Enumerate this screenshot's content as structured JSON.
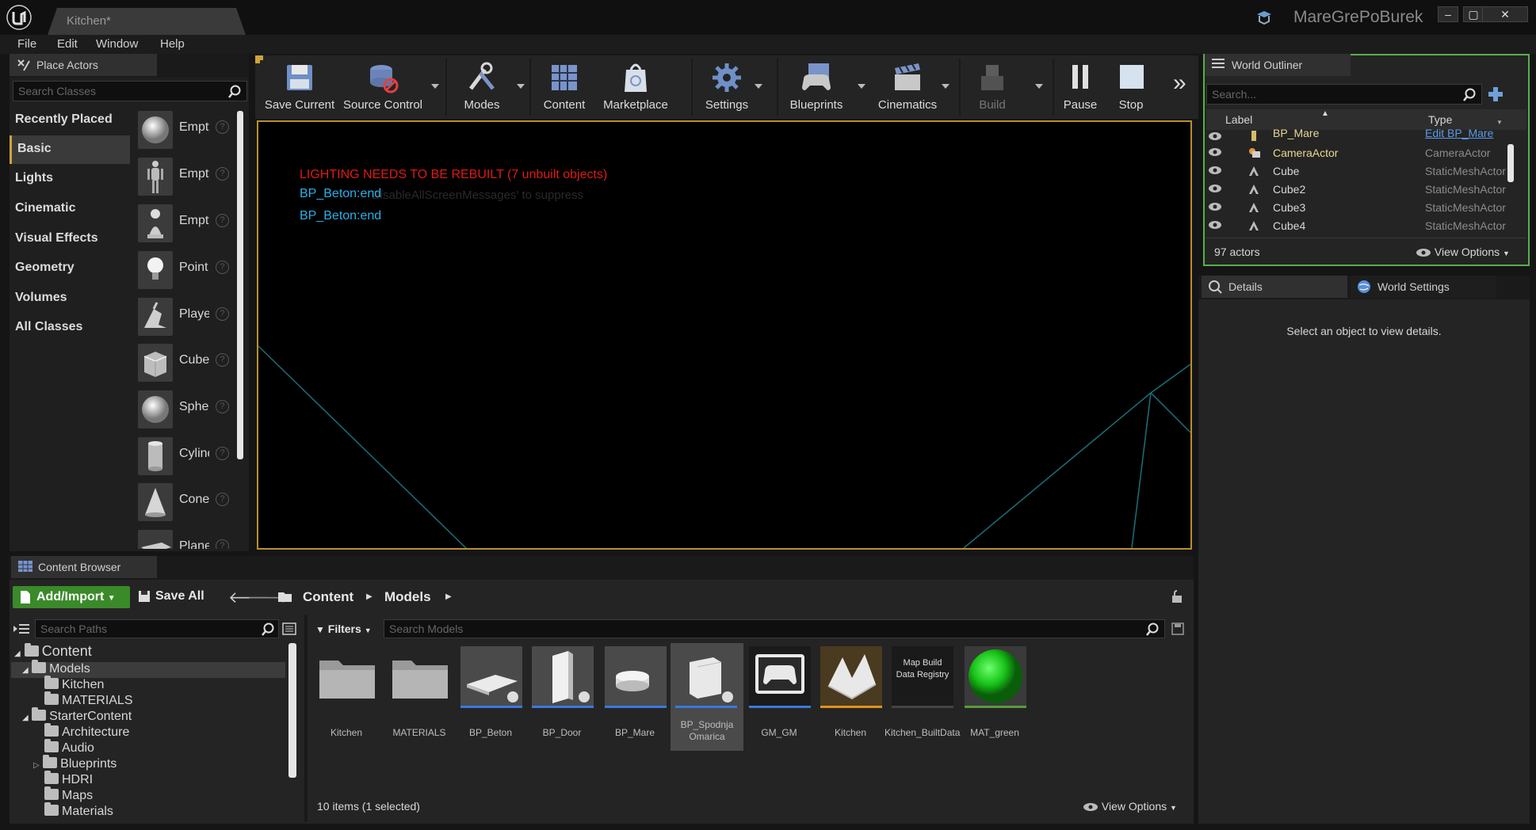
{
  "app": {
    "document_tab": "Kitchen*",
    "project_name": "MareGrePoBurek",
    "window_buttons": [
      "–",
      "▢",
      "✕"
    ]
  },
  "menu": [
    "File",
    "Edit",
    "Window",
    "Help"
  ],
  "place_actors": {
    "tab_label": "Place Actors",
    "search_placeholder": "Search Classes",
    "categories": [
      "Recently Placed",
      "Basic",
      "Lights",
      "Cinematic",
      "Visual Effects",
      "Geometry",
      "Volumes",
      "All Classes"
    ],
    "selected_category": "Basic",
    "actors": [
      "Empty Actor",
      "Empty Character",
      "Empty Pawn",
      "Point Light",
      "Player Start",
      "Cube",
      "Sphere",
      "Cylinder",
      "Cone",
      "Plane"
    ]
  },
  "toolbar": {
    "buttons": [
      "Save Current",
      "Source Control",
      "Modes",
      "Content",
      "Marketplace",
      "Settings",
      "Blueprints",
      "Cinematics",
      "Build",
      "Pause",
      "Stop"
    ],
    "overflow": "»"
  },
  "viewport": {
    "warning": "LIGHTING NEEDS TO BE REBUILT (7 unbuilt objects)",
    "messages": [
      "BP_Beton:end",
      "BP_Beton:end"
    ],
    "faded_hint": "'DisableAllScreenMessages' to suppress"
  },
  "outliner": {
    "tab_label": "World Outliner",
    "search_placeholder": "Search...",
    "columns": [
      "Label",
      "Type"
    ],
    "rows": [
      {
        "label": "BP_Mare",
        "type": "Edit BP_Mare",
        "icon": "blueprint-icon"
      },
      {
        "label": "CameraActor",
        "type": "CameraActor",
        "icon": "camera-icon"
      },
      {
        "label": "Cube",
        "type": "StaticMeshActor",
        "icon": "static-mesh-icon"
      },
      {
        "label": "Cube2",
        "type": "StaticMeshActor",
        "icon": "static-mesh-icon"
      },
      {
        "label": "Cube3",
        "type": "StaticMeshActor",
        "icon": "static-mesh-icon"
      },
      {
        "label": "Cube4",
        "type": "StaticMeshActor",
        "icon": "static-mesh-icon"
      }
    ],
    "actor_count": "97 actors",
    "view_options": "View Options"
  },
  "details": {
    "tabs": [
      "Details",
      "World Settings"
    ],
    "empty_message": "Select an object to view details."
  },
  "content_browser": {
    "tab_label": "Content Browser",
    "add_import": "Add/Import",
    "save_all": "Save All",
    "breadcrumb": [
      "Content",
      "Models"
    ],
    "paths_search_placeholder": "Search Paths",
    "filters_label": "Filters",
    "models_search_placeholder": "Search Models",
    "tree": [
      {
        "label": "Content",
        "level": 0
      },
      {
        "label": "Models",
        "level": 1
      },
      {
        "label": "Kitchen",
        "level": 2
      },
      {
        "label": "MATERIALS",
        "level": 2
      },
      {
        "label": "StarterContent",
        "level": 1
      },
      {
        "label": "Architecture",
        "level": 2
      },
      {
        "label": "Audio",
        "level": 2
      },
      {
        "label": "Blueprints",
        "level": 2
      },
      {
        "label": "HDRI",
        "level": 2
      },
      {
        "label": "Maps",
        "level": 2
      },
      {
        "label": "Materials",
        "level": 2
      }
    ],
    "assets": [
      {
        "name": "Kitchen",
        "kind": "folder"
      },
      {
        "name": "MATERIALS",
        "kind": "folder"
      },
      {
        "name": "BP_Beton",
        "kind": "blueprint"
      },
      {
        "name": "BP_Door",
        "kind": "blueprint"
      },
      {
        "name": "BP_Mare",
        "kind": "blueprint"
      },
      {
        "name": "BP_Spodnja Omarica",
        "kind": "blueprint"
      },
      {
        "name": "GM_GM",
        "kind": "gamemode"
      },
      {
        "name": "Kitchen",
        "kind": "map"
      },
      {
        "name": "Kitchen_BuiltData",
        "kind": "builddata",
        "thumb_text": "Map Build Data Registry"
      },
      {
        "name": "MAT_green",
        "kind": "material"
      }
    ],
    "selected_asset": "BP_Spodnja Omarica",
    "status": "10 items (1 selected)",
    "view_options": "View Options"
  },
  "colors": {
    "accent": "#cfa43a",
    "outliner_border": "#55b04a",
    "warning_red": "#e01818",
    "message_cyan": "#2ab0e8",
    "add_import_green": "#3a8a2a"
  }
}
